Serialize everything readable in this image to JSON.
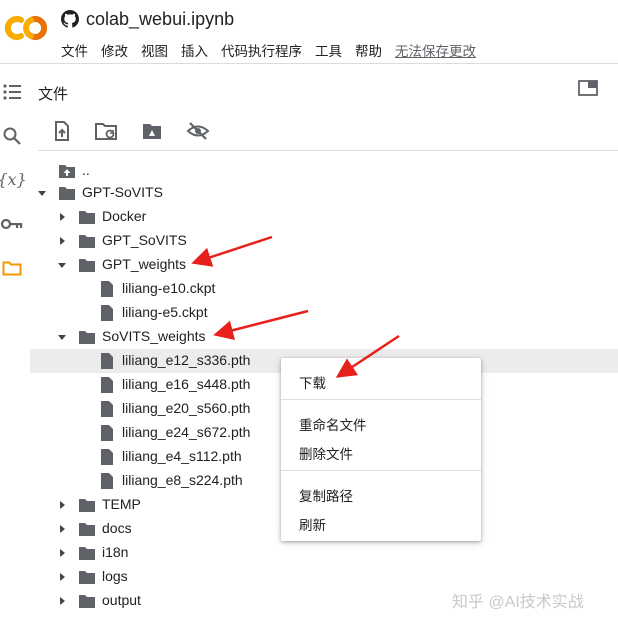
{
  "header": {
    "title": "colab_webui.ipynb",
    "menu": [
      "文件",
      "修改",
      "视图",
      "插入",
      "代码执行程序",
      "工具",
      "帮助"
    ],
    "unsaved_note": "无法保存更改"
  },
  "rail": {
    "icons": [
      "table-of-contents-icon",
      "search-icon",
      "variables-icon",
      "key-icon",
      "folder-icon"
    ],
    "variables_glyph": "{x}"
  },
  "files_panel": {
    "title": "文件",
    "toolbar": [
      "upload-file-icon",
      "refresh-folder-icon",
      "mount-drive-icon",
      "hide-files-icon"
    ]
  },
  "tree": [
    {
      "label": "..",
      "type": "parent-folder",
      "level": 0
    },
    {
      "label": "GPT-SoVITS",
      "type": "folder",
      "expanded": true,
      "level": 0
    },
    {
      "label": "Docker",
      "type": "folder",
      "expanded": false,
      "level": 1
    },
    {
      "label": "GPT_SoVITS",
      "type": "folder",
      "expanded": false,
      "level": 1
    },
    {
      "label": "GPT_weights",
      "type": "folder",
      "expanded": true,
      "level": 1
    },
    {
      "label": "liliang-e10.ckpt",
      "type": "file",
      "level": 2
    },
    {
      "label": "liliang-e5.ckpt",
      "type": "file",
      "level": 2
    },
    {
      "label": "SoVITS_weights",
      "type": "folder",
      "expanded": true,
      "level": 1
    },
    {
      "label": "liliang_e12_s336.pth",
      "type": "file",
      "level": 2,
      "selected": true
    },
    {
      "label": "liliang_e16_s448.pth",
      "type": "file",
      "level": 2
    },
    {
      "label": "liliang_e20_s560.pth",
      "type": "file",
      "level": 2
    },
    {
      "label": "liliang_e24_s672.pth",
      "type": "file",
      "level": 2
    },
    {
      "label": "liliang_e4_s112.pth",
      "type": "file",
      "level": 2
    },
    {
      "label": "liliang_e8_s224.pth",
      "type": "file",
      "level": 2
    },
    {
      "label": "TEMP",
      "type": "folder",
      "expanded": false,
      "level": 1
    },
    {
      "label": "docs",
      "type": "folder",
      "expanded": false,
      "level": 1
    },
    {
      "label": "i18n",
      "type": "folder",
      "expanded": false,
      "level": 1
    },
    {
      "label": "logs",
      "type": "folder",
      "expanded": false,
      "level": 1
    },
    {
      "label": "output",
      "type": "folder",
      "expanded": false,
      "level": 1
    }
  ],
  "context_menu": {
    "download": "下载",
    "rename": "重命名文件",
    "delete": "删除文件",
    "copy_path": "复制路径",
    "refresh": "刷新"
  },
  "annotations": {
    "arrow_color": "#e8201b",
    "arrow_count": 3
  },
  "watermark": "知乎 @AI技术实战",
  "colors": {
    "logo_orange": "#f9ab00",
    "logo_deep": "#e8710a",
    "folder_icon": "#f29900",
    "icon_gray": "#5f6368"
  }
}
